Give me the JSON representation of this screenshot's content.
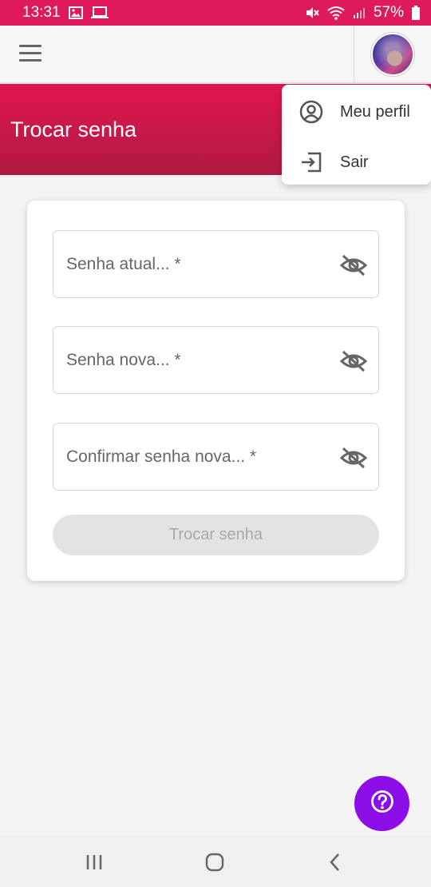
{
  "status_bar": {
    "time": "13:31",
    "battery": "57%"
  },
  "app_bar": {
    "menu_icon": "hamburger-icon",
    "avatar": "user-avatar"
  },
  "banner": {
    "title": "Trocar senha"
  },
  "user_menu": {
    "items": [
      {
        "label": "Meu perfil",
        "icon": "user-circle-icon"
      },
      {
        "label": "Sair",
        "icon": "logout-icon"
      }
    ]
  },
  "form": {
    "current_password": {
      "placeholder": "Senha atual... *",
      "value": ""
    },
    "new_password": {
      "placeholder": "Senha nova... *",
      "value": ""
    },
    "confirm_password": {
      "placeholder": "Confirmar senha nova... *",
      "value": ""
    },
    "submit_label": "Trocar senha"
  },
  "help_fab": {
    "icon": "question-circle-icon"
  },
  "colors": {
    "status_bar": "#de1a5a",
    "banner_top": "#e11650",
    "banner_bottom": "#b01a42",
    "fab": "#8c0de6",
    "button_disabled": "#e3e3e3"
  }
}
